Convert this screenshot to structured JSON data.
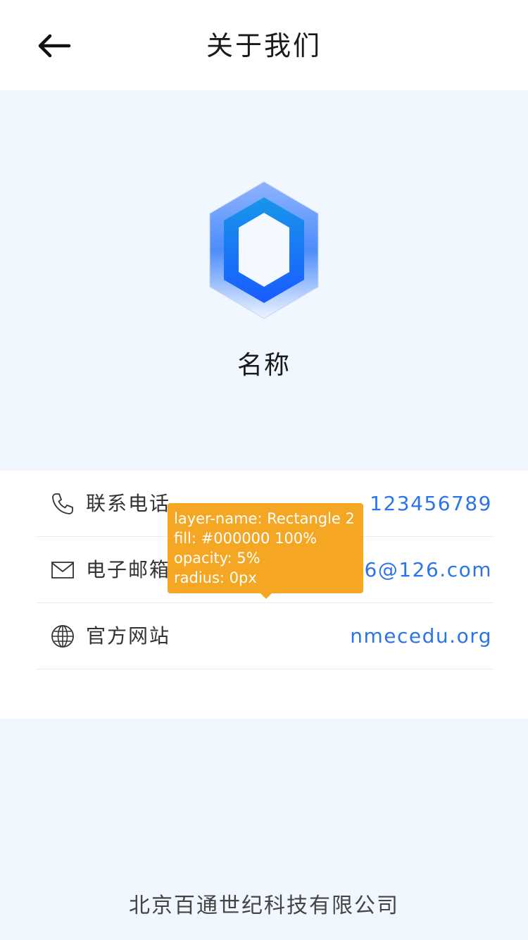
{
  "nav": {
    "title": "关于我们",
    "back_icon": "arrow-left-icon"
  },
  "hero": {
    "app_name": "名称",
    "logo_icon": "hexagon-logo-icon"
  },
  "contact": [
    {
      "icon": "phone-icon",
      "label": "联系电话",
      "value": "123456789"
    },
    {
      "icon": "mail-icon",
      "label": "电子邮箱",
      "value": "123456@126.com"
    },
    {
      "icon": "globe-icon",
      "label": "官方网站",
      "value": "nmecedu.org"
    }
  ],
  "tooltip": {
    "line1": "layer-name: Rectangle 2",
    "line2": "fill: #000000 100%",
    "line3": "opacity: 5%",
    "line4": "radius: 0px"
  },
  "footer": {
    "company": "北京百通世纪科技有限公司"
  },
  "colors": {
    "accent": "#2b74ea",
    "background": "#f0f7fe",
    "tooltip": "#f5a623"
  }
}
